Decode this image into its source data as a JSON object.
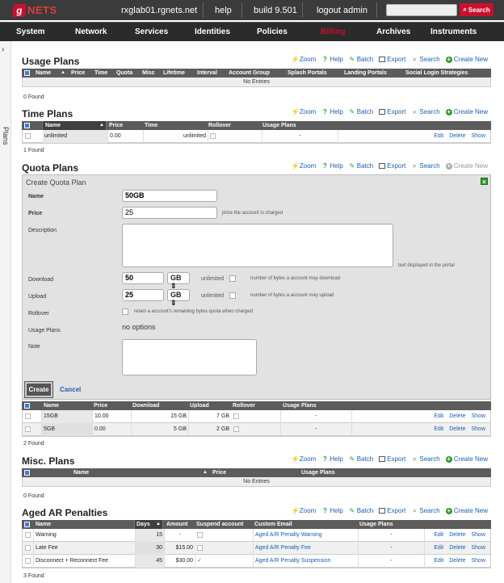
{
  "topbar": {
    "logo_letter": "g",
    "logo_text": "NETS",
    "host": "rxglab01.rgnets.net",
    "help": "help",
    "build": "build 9.501",
    "logout": "logout admin",
    "search_button": "Search"
  },
  "menu": [
    "System",
    "Network",
    "Services",
    "Identities",
    "Policies",
    "Billing",
    "Archives",
    "Instruments"
  ],
  "sidebar": {
    "label": "Plans",
    "arrow": "›"
  },
  "actions": {
    "zoom": "Zoom",
    "help": "Help",
    "batch": "Batch",
    "export": "Export",
    "search": "Search",
    "create": "Create New"
  },
  "usage_plans": {
    "title": "Usage Plans",
    "columns": [
      "Name",
      "Price",
      "Time",
      "Quota",
      "Misc",
      "Lifetime",
      "Interval",
      "Account Group",
      "Splash Portals",
      "Landing Portals",
      "Social Login Strategies"
    ],
    "empty": "No Entries",
    "found": "0 Found"
  },
  "time_plans": {
    "title": "Time Plans",
    "columns": [
      "Name",
      "Price",
      "Time",
      "Rollover",
      "Usage Plans"
    ],
    "rows": [
      {
        "name": "unlimited",
        "price": "0.00",
        "time": "unlimited",
        "usage": "-"
      }
    ],
    "row_links": [
      "Edit",
      "Delete",
      "Show"
    ],
    "found": "1 Found"
  },
  "quota_plans": {
    "title": "Quota Plans",
    "form": {
      "title": "Create Quota Plan",
      "name_label": "Name",
      "name_value": "50GB",
      "price_label": "Price",
      "price_value": "25",
      "price_hint": "price the account is charged",
      "description_label": "Description",
      "description_hint": "text displayed in the portal",
      "download_label": "Download",
      "download_value": "50",
      "download_unit": "GB",
      "download_unlimited": "unlimited",
      "download_hint": "number of bytes a account may download",
      "upload_label": "Upload",
      "upload_value": "25",
      "upload_unit": "GB",
      "upload_unlimited": "unlimited",
      "upload_hint": "number of bytes a account may upload",
      "rollover_label": "Rollover",
      "rollover_hint": "retain a account's remaining bytes quota when charged",
      "usage_label": "Usage Plans",
      "usage_value": "no options",
      "note_label": "Note",
      "create": "Create",
      "cancel": "Cancel"
    },
    "columns": [
      "Name",
      "Price",
      "Download",
      "Upload",
      "Rollover",
      "Usage Plans"
    ],
    "rows": [
      {
        "name": "15GB",
        "price": "10.00",
        "download": "15 GB",
        "upload": "7 GB",
        "usage": "-"
      },
      {
        "name": "5GB",
        "price": "0.00",
        "download": "5 GB",
        "upload": "2 GB",
        "usage": "-"
      }
    ],
    "row_links": [
      "Edit",
      "Delete",
      "Show"
    ],
    "found": "2 Found"
  },
  "misc_plans": {
    "title": "Misc. Plans",
    "columns": [
      "Name",
      "Price",
      "Usage Plans"
    ],
    "empty": "No Entries",
    "found": "0 Found"
  },
  "aged_ar": {
    "title": "Aged AR Penalties",
    "columns": [
      "Name",
      "Days",
      "Amount",
      "Suspend account",
      "Custom Email",
      "Usage Plans"
    ],
    "rows": [
      {
        "name": "Warning",
        "days": "15",
        "amount": "-",
        "suspend": "",
        "email": "Aged A/R Penalty Warning",
        "usage": "-"
      },
      {
        "name": "Late Fee",
        "days": "30",
        "amount": "$15.00",
        "suspend": "",
        "email": "Aged A/R Penalty Fee",
        "usage": "-"
      },
      {
        "name": "Disconnect + Reconnect Fee",
        "days": "45",
        "amount": "$30.00",
        "suspend": "✓",
        "email": "Aged A/R Penalty Suspension",
        "usage": "-"
      }
    ],
    "row_links": [
      "Edit",
      "Delete",
      "Show"
    ],
    "found": "3 Found"
  },
  "colors": {
    "brand_red": "#c8102e",
    "link_blue": "#1a5fb4",
    "header_gray": "#5c5c5c"
  }
}
